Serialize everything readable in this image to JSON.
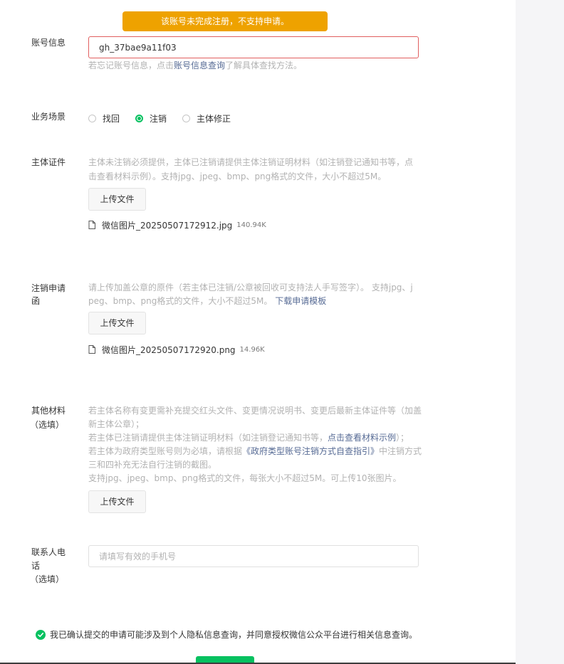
{
  "banner": {
    "text": "该账号未完成注册，不支持申请。"
  },
  "account": {
    "label": "账号信息",
    "value": "gh_37bae9a11f03",
    "hint_prefix": "若忘记账号信息，点击",
    "hint_link": "账号信息查询",
    "hint_suffix": "了解具体查找方法。"
  },
  "scenario": {
    "label": "业务场景",
    "options": [
      {
        "label": "找回",
        "checked": false
      },
      {
        "label": "注销",
        "checked": true
      },
      {
        "label": "主体修正",
        "checked": false
      }
    ]
  },
  "certificate": {
    "label": "主体证件",
    "desc_line1": "主体未注销必须提供，主体已注销请提供主体注销证明材料（如注销登记通知书等，点",
    "desc_line2": "击查看材料示例）。支持jpg、jpeg、bmp、png格式的文件，大小不超过5M。",
    "upload_label": "上传文件",
    "file": {
      "name": "微信图片_20250507172912.jpg",
      "size": "140.94K"
    }
  },
  "application_letter": {
    "label_line1": "注销申请",
    "label_line2": "函",
    "desc_line1": "请上传加盖公章的原件（若主体已注销/公章被回收可支持法人手写签字）。 支持jpg、j",
    "desc_line2": "peg、bmp、png格式的文件，大小不超过5M。",
    "desc_link": "下载申请模板",
    "upload_label": "上传文件",
    "file": {
      "name": "微信图片_20250507172920.png",
      "size": "14.96K"
    }
  },
  "other": {
    "label_line1": "其他材料",
    "label_line2": "（选填）",
    "line1": "若主体名称有变更需补充提交红头文件、变更情况说明书、变更后最新主体证件等（加盖",
    "line2": "新主体公章）；",
    "line3_prefix": "若主体已注销请提供主体注销证明材料（如注销登记通知书等，",
    "line3_link": "点击查看材料示例",
    "line3_suffix": "）；",
    "line4_prefix": "若主体为政府类型账号则为必填，请根据",
    "line4_link": "《政府类型账号注销方式自查指引》",
    "line4_suffix": "中注销方式",
    "line5": "三和四补充无法自行注销的截图。",
    "line6": "支持jpg、jpeg、bmp、png格式的文件，每张大小不超过5M。可上传10张图片。",
    "upload_label": "上传文件"
  },
  "contact": {
    "label_line1": "联系人电",
    "label_line2": "话",
    "label_line3": "（选填）",
    "placeholder": "请填写有效的手机号"
  },
  "agreement": {
    "text": "我已确认提交的申请可能涉及到个人隐私信息查询，并同意授权微信公众平台进行相关信息查询。"
  },
  "colors": {
    "accent": "#07c160",
    "warning": "#eea200",
    "error_border": "#e15f5f",
    "link": "#576b95"
  },
  "icons": {
    "file": "file-icon",
    "check": "check-circle-icon"
  }
}
